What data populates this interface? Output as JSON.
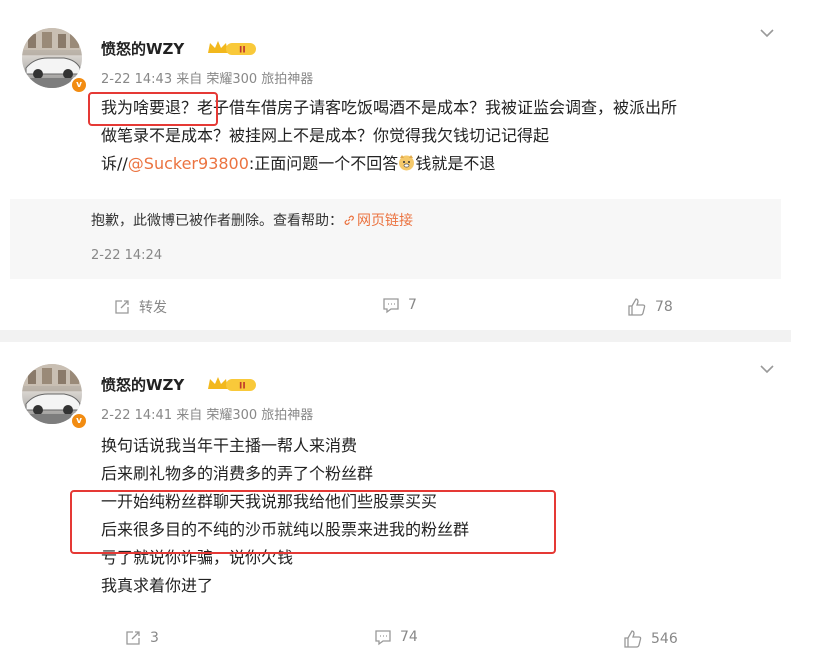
{
  "posts": [
    {
      "username": "愤怒的WZY",
      "vip_badge_text": "II",
      "meta": "2-22 14:43 来自 荣耀300 旅拍神器",
      "content": {
        "line1": "我为啥要退？老子借车借房子请客吃饭喝酒不是成本？我被证监会调查，被派出所",
        "line2": "做笔录不是成本？被挂网上不是成本？你觉得我欠钱切记记得起",
        "line3_prefix": "诉//",
        "mention": "@Sucker93800",
        "line3_suffix": ":正面问题一个不回答",
        "emoji": "doge-emoji",
        "line3_end": "钱就是不退"
      },
      "retweet": {
        "notice": "抱歉，此微博已被作者删除。查看帮助：",
        "help_link": "网页链接",
        "time": "2-22 14:24"
      },
      "actions": {
        "repost": "转发",
        "comment": "7",
        "like": "78"
      }
    },
    {
      "username": "愤怒的WZY",
      "vip_badge_text": "II",
      "meta": "2-22 14:41 来自 荣耀300 旅拍神器",
      "lines": [
        "换句话说我当年干主播一帮人来消费",
        "后来刷礼物多的消费多的弄了个粉丝群",
        "一开始纯粉丝群聊天我说那我给他们些股票买买",
        "后来很多目的不纯的沙币就纯以股票来进我的粉丝群",
        "亏了就说你诈骗，说你欠钱",
        "我真求着你进了"
      ],
      "actions": {
        "repost": "3",
        "comment": "74",
        "like": "546"
      }
    }
  ],
  "colors": {
    "accent": "#eb7340",
    "highlight_box": "#e53935",
    "vip_gold": "#f2b81d",
    "v_badge": "#f28c12"
  }
}
